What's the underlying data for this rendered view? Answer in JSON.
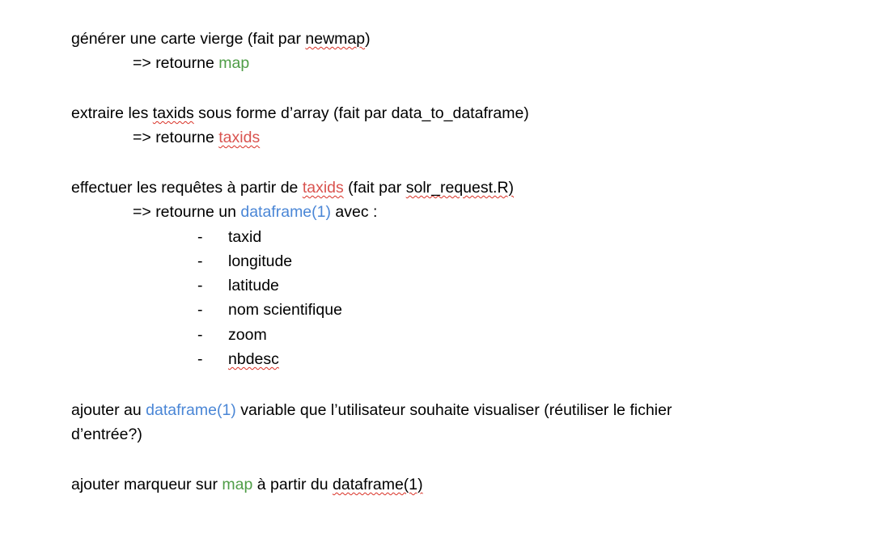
{
  "document": {
    "step1": {
      "prefix": "générer une carte vierge (fait par ",
      "func": "newmap",
      "suffix": ")",
      "return_prefix": "=> retourne ",
      "return_value": "map"
    },
    "step2": {
      "prefix": "extraire les ",
      "taxids_word": "taxids",
      "suffix": " sous forme d’array (fait par data_to_dataframe)",
      "return_prefix": "=> retourne ",
      "return_value": "taxids"
    },
    "step3": {
      "prefix": "effectuer les requêtes à partir de ",
      "taxids_word": "taxids",
      "middle": " (fait par ",
      "func": "solr_request.R)",
      "return_prefix": "=> retourne un ",
      "return_value": "dataframe(1)",
      "return_suffix": " avec :",
      "bullets": [
        "taxid",
        "longitude",
        "latitude",
        "nom scientifique",
        "zoom",
        "nbdesc"
      ],
      "dash": "-"
    },
    "step4": {
      "prefix": "ajouter au ",
      "df": "dataframe(1)",
      "suffix": " variable que l’utilisateur souhaite visualiser (réutiliser le fichier",
      "line2": "d’entrée?)"
    },
    "step5": {
      "prefix": "ajouter marqueur sur ",
      "map": "map",
      "middle": " à partir du ",
      "df": "dataframe(1)"
    },
    "colors": {
      "green": "#4f9d47",
      "red": "#d9534f",
      "blue": "#4a86d6",
      "spellcheck": "#d93025"
    }
  }
}
